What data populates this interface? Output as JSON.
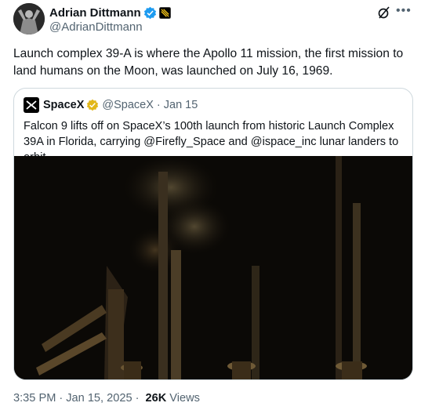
{
  "author": {
    "display_name": "Adrian Dittmann",
    "handle": "@AdrianDittmann",
    "verified_icon": "verified-badge-icon",
    "affiliate_icon": "affiliate-badge-icon",
    "avatar_icon": "avatar-statue"
  },
  "actions": {
    "grok_icon": "grok-icon",
    "more_icon": "more-icon"
  },
  "tweet": {
    "text": "Launch complex 39-A is where the Apollo 11 mission, the first mission to land humans on the Moon, was launched on July 16, 1969."
  },
  "quoted": {
    "display_name": "SpaceX",
    "handle": "@SpaceX",
    "separator": "·",
    "date": "Jan 15",
    "text": "Falcon 9 lifts off on SpaceX’s 100th launch from historic Launch Complex 39A in Florida, carrying @Firefly_Space and @ispace_inc  lunar landers to orbit",
    "media_icon": "launch-video"
  },
  "meta": {
    "time": "3:35 PM",
    "separator1": "·",
    "date": "Jan 15, 2025",
    "separator2": "·",
    "views_count": "26K",
    "views_label": "Views"
  },
  "colors": {
    "text": "#0f1419",
    "secondary": "#536471",
    "border": "#cfd9de",
    "verified_blue": "#1d9bf0",
    "verified_gold": "#e2b719"
  }
}
